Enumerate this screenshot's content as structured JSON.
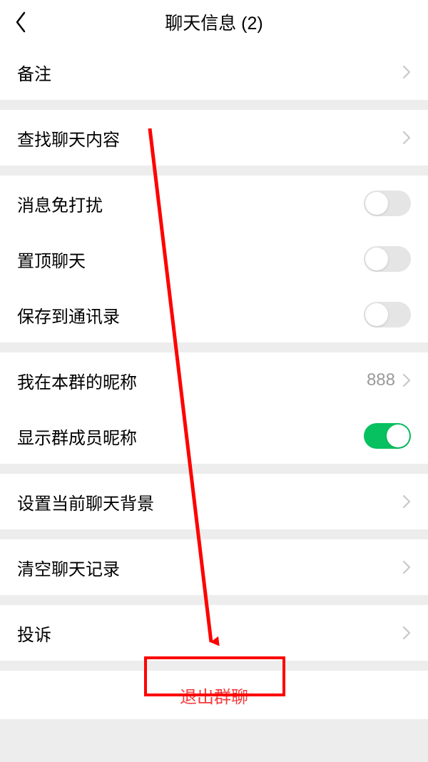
{
  "header": {
    "title": "聊天信息 (2)"
  },
  "rows": {
    "remark": {
      "label": "备注"
    },
    "search": {
      "label": "查找聊天内容"
    },
    "mute": {
      "label": "消息免打扰",
      "on": false
    },
    "pin": {
      "label": "置顶聊天",
      "on": false
    },
    "saveContacts": {
      "label": "保存到通讯录",
      "on": false
    },
    "nickname": {
      "label": "我在本群的昵称",
      "value": "888"
    },
    "showMemberNick": {
      "label": "显示群成员昵称",
      "on": true
    },
    "background": {
      "label": "设置当前聊天背景"
    },
    "clearHistory": {
      "label": "清空聊天记录"
    },
    "complaint": {
      "label": "投诉"
    },
    "quit": {
      "label": "退出群聊"
    }
  }
}
